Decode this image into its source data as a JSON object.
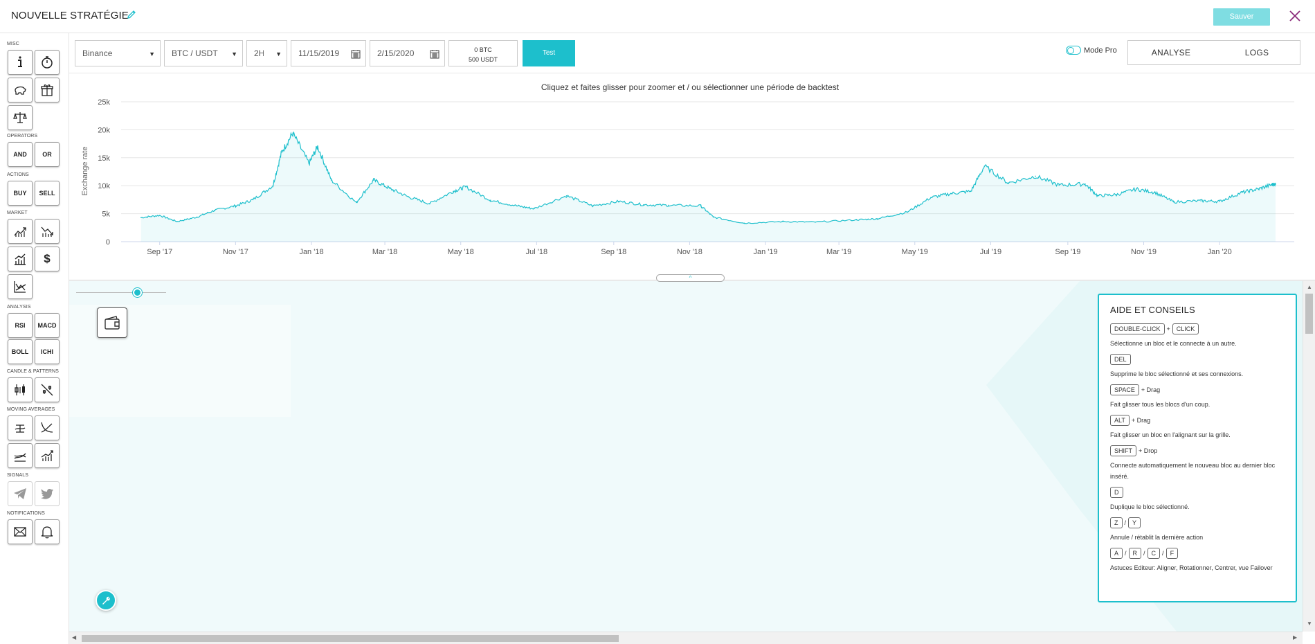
{
  "header": {
    "title": "NOUVELLE STRATÉGIE",
    "save_label": "Sauver"
  },
  "palette": {
    "categories": [
      "MISC",
      "OPERATORS",
      "ACTIONS",
      "MARKET",
      "ANALYSIS",
      "CANDLE & PATTERNS",
      "MOVING AVERAGES",
      "SIGNALS",
      "NOTIFICATIONS"
    ],
    "operators": [
      "AND",
      "OR"
    ],
    "actions": [
      "BUY",
      "SELL"
    ],
    "analysis": [
      "RSI",
      "MACD",
      "BOLL",
      "ICHI"
    ],
    "market_price_symbol": "$"
  },
  "toolbar": {
    "exchange": "Binance",
    "pair": "BTC / USDT",
    "interval": "2H",
    "start_date": "11/15/2019",
    "end_date": "2/15/2020",
    "balance_btc": "0 BTC",
    "balance_usdt": "500 USDT",
    "test_label": "Test",
    "mode_pro_label": "Mode Pro",
    "tabs": [
      "ANALYSE",
      "LOGS"
    ]
  },
  "chart_data": {
    "type": "area",
    "title": "Cliquez et faites glisser pour zoomer et / ou sélectionner une période de backtest",
    "ylabel": "Exchange rate",
    "ylim": [
      0,
      25000
    ],
    "y_ticks": [
      "0",
      "5k",
      "10k",
      "15k",
      "20k",
      "25k"
    ],
    "x_ticks": [
      "Sep '17",
      "Nov '17",
      "Jan '18",
      "Mar '18",
      "May '18",
      "Jul '18",
      "Sep '18",
      "Nov '18",
      "Jan '19",
      "Mar '19",
      "May '19",
      "Jul '19",
      "Sep '19",
      "Nov '19",
      "Jan '20"
    ],
    "x": [
      "2017-08-17",
      "2017-09-01",
      "2017-09-15",
      "2017-10-01",
      "2017-10-15",
      "2017-11-01",
      "2017-11-15",
      "2017-12-01",
      "2017-12-08",
      "2017-12-17",
      "2017-12-30",
      "2018-01-06",
      "2018-01-17",
      "2018-02-06",
      "2018-02-20",
      "2018-03-05",
      "2018-03-20",
      "2018-04-06",
      "2018-04-25",
      "2018-05-05",
      "2018-05-25",
      "2018-06-15",
      "2018-06-29",
      "2018-07-25",
      "2018-08-15",
      "2018-09-05",
      "2018-09-25",
      "2018-10-15",
      "2018-11-10",
      "2018-11-20",
      "2018-12-15",
      "2019-01-15",
      "2019-02-10",
      "2019-03-15",
      "2019-04-01",
      "2019-04-25",
      "2019-05-14",
      "2019-05-30",
      "2019-06-15",
      "2019-06-26",
      "2019-07-15",
      "2019-08-06",
      "2019-08-25",
      "2019-09-15",
      "2019-09-25",
      "2019-10-10",
      "2019-10-26",
      "2019-11-10",
      "2019-11-25",
      "2019-12-17",
      "2020-01-01",
      "2020-01-19",
      "2020-02-01",
      "2020-02-12",
      "2020-02-15"
    ],
    "values": [
      4300,
      4700,
      3600,
      4400,
      5600,
      6400,
      7500,
      10000,
      16000,
      19400,
      14000,
      17000,
      11000,
      7000,
      11000,
      9500,
      8000,
      6800,
      9000,
      9800,
      7400,
      6400,
      5900,
      8200,
      6400,
      7200,
      6600,
      6500,
      6400,
      4400,
      3300,
      3600,
      3500,
      3900,
      4100,
      5300,
      7900,
      8600,
      9000,
      13500,
      10500,
      11700,
      10100,
      10300,
      8200,
      8400,
      9400,
      8800,
      7100,
      7300,
      7200,
      8800,
      9400,
      10200,
      10300
    ],
    "grid": true,
    "legend": "none"
  },
  "help": {
    "title": "AIDE ET CONSEILS",
    "plus": "+",
    "slash": "/",
    "items": [
      {
        "keys": [
          "DOUBLE-CLICK",
          "CLICK"
        ],
        "desc": "Sélectionne un bloc et le connecte à un autre."
      },
      {
        "keys": [
          "DEL"
        ],
        "desc": "Supprime le bloc sélectionné et ses connexions."
      },
      {
        "keys": [
          "SPACE"
        ],
        "suffix": "+ Drag",
        "desc": "Fait glisser tous les blocs d'un coup."
      },
      {
        "keys": [
          "ALT"
        ],
        "suffix": "+ Drag",
        "desc": "Fait glisser un bloc en l'alignant sur la grille."
      },
      {
        "keys": [
          "SHIFT"
        ],
        "suffix": "+ Drop",
        "desc": "Connecte automatiquement le nouveau bloc au dernier bloc inséré."
      },
      {
        "keys": [
          "D"
        ],
        "desc": "Duplique le bloc sélectionné."
      },
      {
        "keys": [
          "Z",
          "Y"
        ],
        "desc": "Annule / rétablit la dernière action"
      },
      {
        "keys": [
          "A",
          "R",
          "C",
          "F"
        ],
        "desc": "Astuces Editeur: Aligner, Rotationner, Centrer, vue Failover"
      }
    ]
  },
  "colors": {
    "accent": "#1dbfcc",
    "save_disabled": "#7fdde2",
    "close": "#8b2a7a",
    "canvas_bg": "#f0fafb"
  }
}
